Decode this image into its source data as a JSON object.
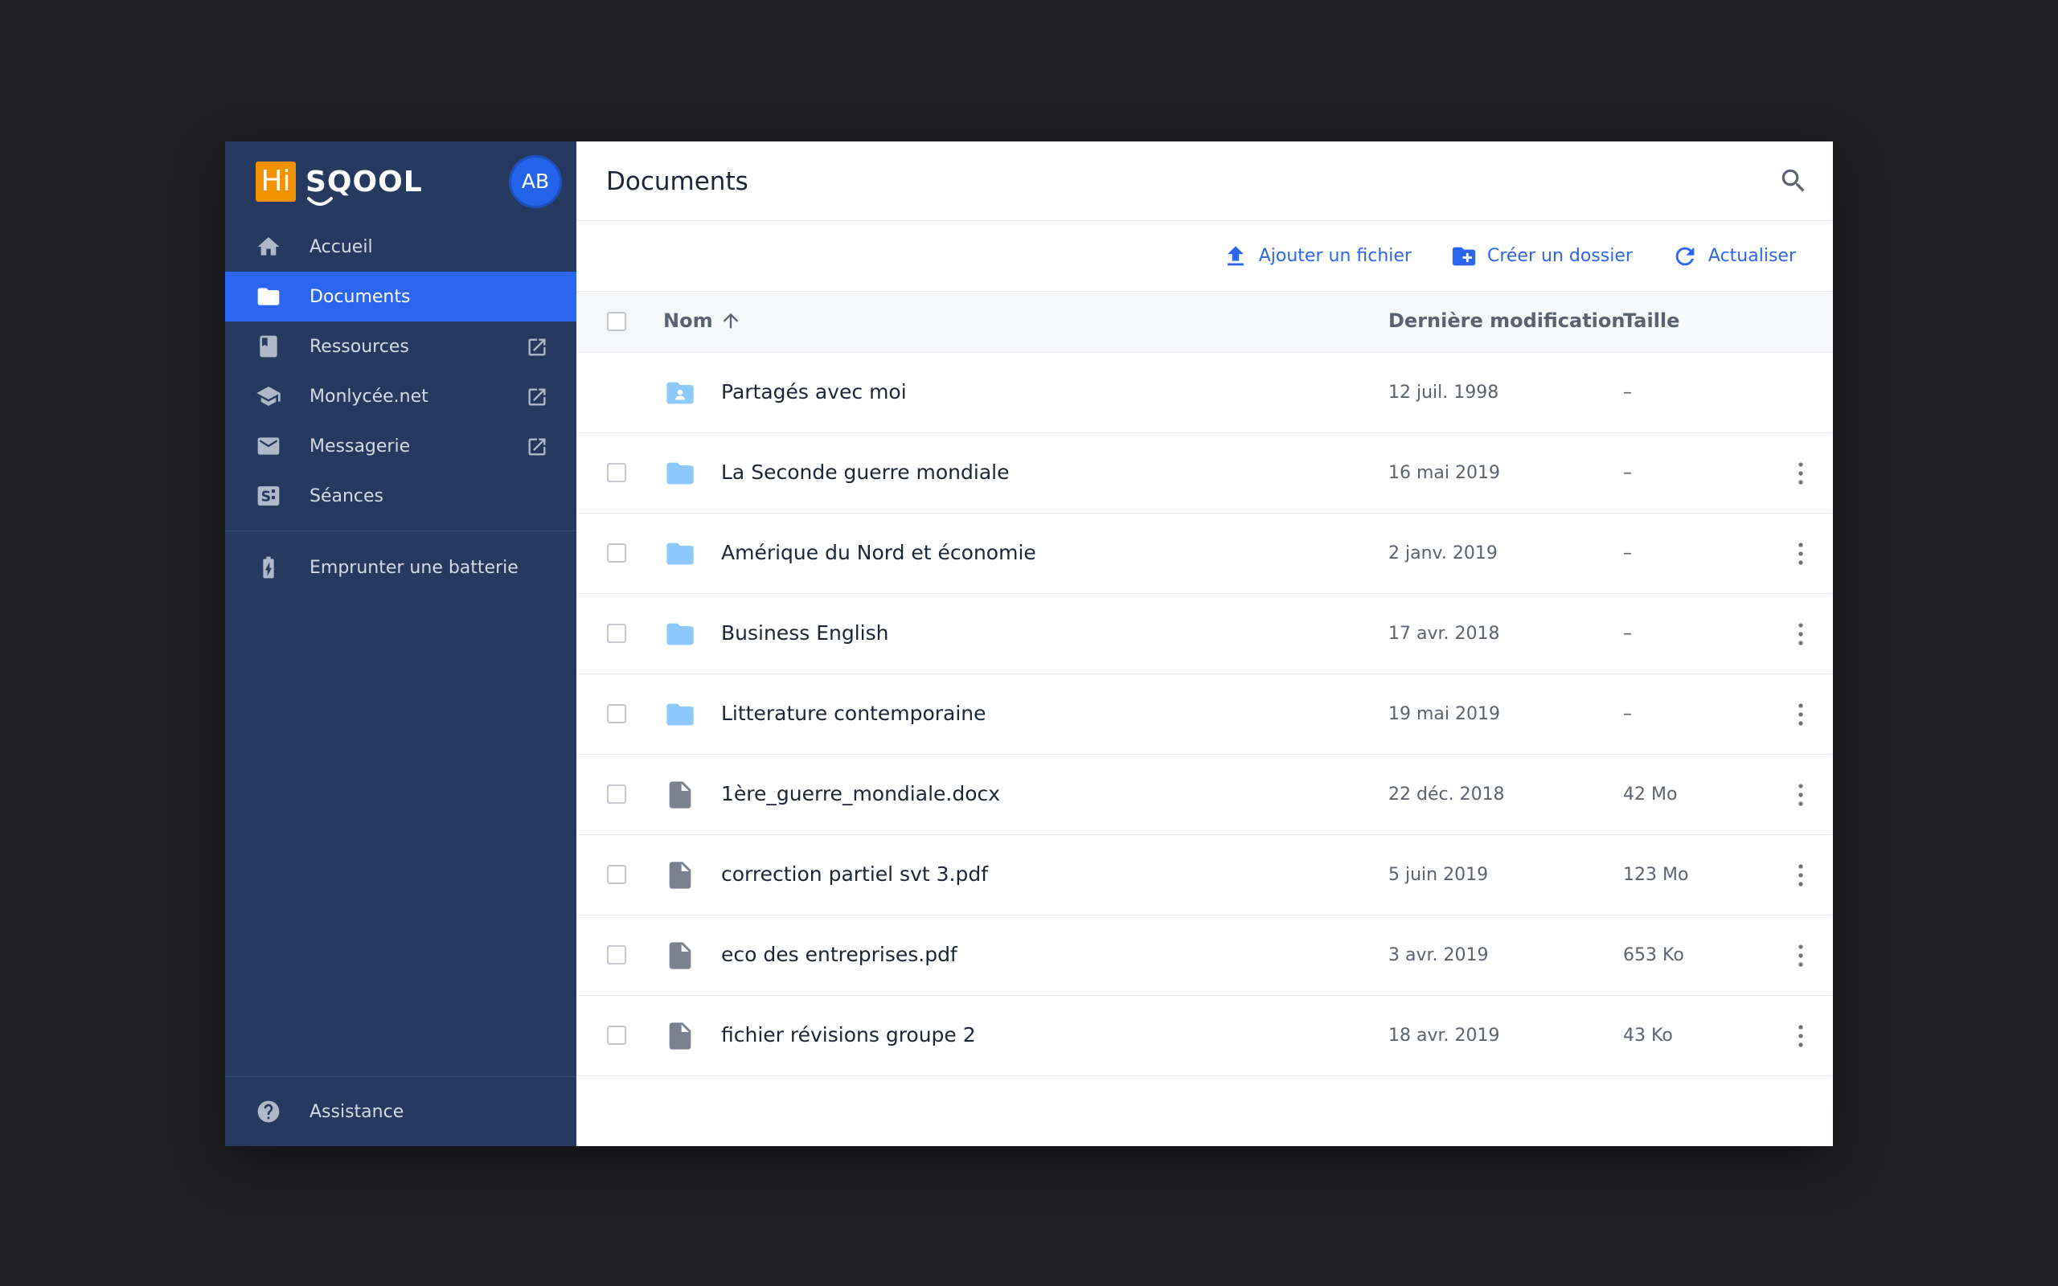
{
  "brand": {
    "hi": "Hi",
    "name": "SQOOL",
    "accent": "#f39200"
  },
  "user": {
    "initials": "AB"
  },
  "sidebar": {
    "items": [
      {
        "label": "Accueil",
        "icon": "home-icon"
      },
      {
        "label": "Documents",
        "icon": "folder-icon",
        "active": true
      },
      {
        "label": "Ressources",
        "icon": "book-icon",
        "external": true
      },
      {
        "label": "Monlycée.net",
        "icon": "school-icon",
        "external": true
      },
      {
        "label": "Messagerie",
        "icon": "mail-icon",
        "external": true
      },
      {
        "label": "Séances",
        "icon": "sessions-icon"
      }
    ],
    "extra": {
      "label": "Emprunter une batterie",
      "icon": "battery-icon"
    },
    "bottom": {
      "label": "Assistance",
      "icon": "help-icon"
    }
  },
  "main": {
    "title": "Documents",
    "toolbar": {
      "add_file": "Ajouter un fichier",
      "create_folder": "Créer un dossier",
      "refresh": "Actualiser"
    },
    "columns": {
      "name": "Nom",
      "modified": "Dernière modification",
      "size": "Taille"
    },
    "rows": [
      {
        "name": "Partagés avec moi",
        "modified": "12 juil. 1998",
        "size": "–",
        "type": "shared-folder"
      },
      {
        "name": "La Seconde guerre mondiale",
        "modified": "16 mai 2019",
        "size": "–",
        "type": "folder"
      },
      {
        "name": "Amérique du Nord et économie",
        "modified": "2 janv. 2019",
        "size": "–",
        "type": "folder"
      },
      {
        "name": "Business English",
        "modified": "17 avr. 2018",
        "size": "–",
        "type": "folder"
      },
      {
        "name": "Litterature contemporaine",
        "modified": "19 mai 2019",
        "size": "–",
        "type": "folder"
      },
      {
        "name": "1ère_guerre_mondiale.docx",
        "modified": "22 déc. 2018",
        "size": "42 Mo",
        "type": "file"
      },
      {
        "name": "correction partiel svt 3.pdf",
        "modified": "5 juin 2019",
        "size": "123 Mo",
        "type": "file"
      },
      {
        "name": "eco des entreprises.pdf",
        "modified": "3 avr. 2019",
        "size": "653 Ko",
        "type": "file"
      },
      {
        "name": "fichier révisions groupe 2",
        "modified": "18 avr. 2019",
        "size": "43 Ko",
        "type": "file"
      }
    ]
  },
  "colors": {
    "sidebar_bg": "#253a5e",
    "active_item": "#2c65f0",
    "link_blue": "#2c65f0",
    "folder_blue": "#8ec9fb",
    "file_gray": "#7a8290"
  }
}
